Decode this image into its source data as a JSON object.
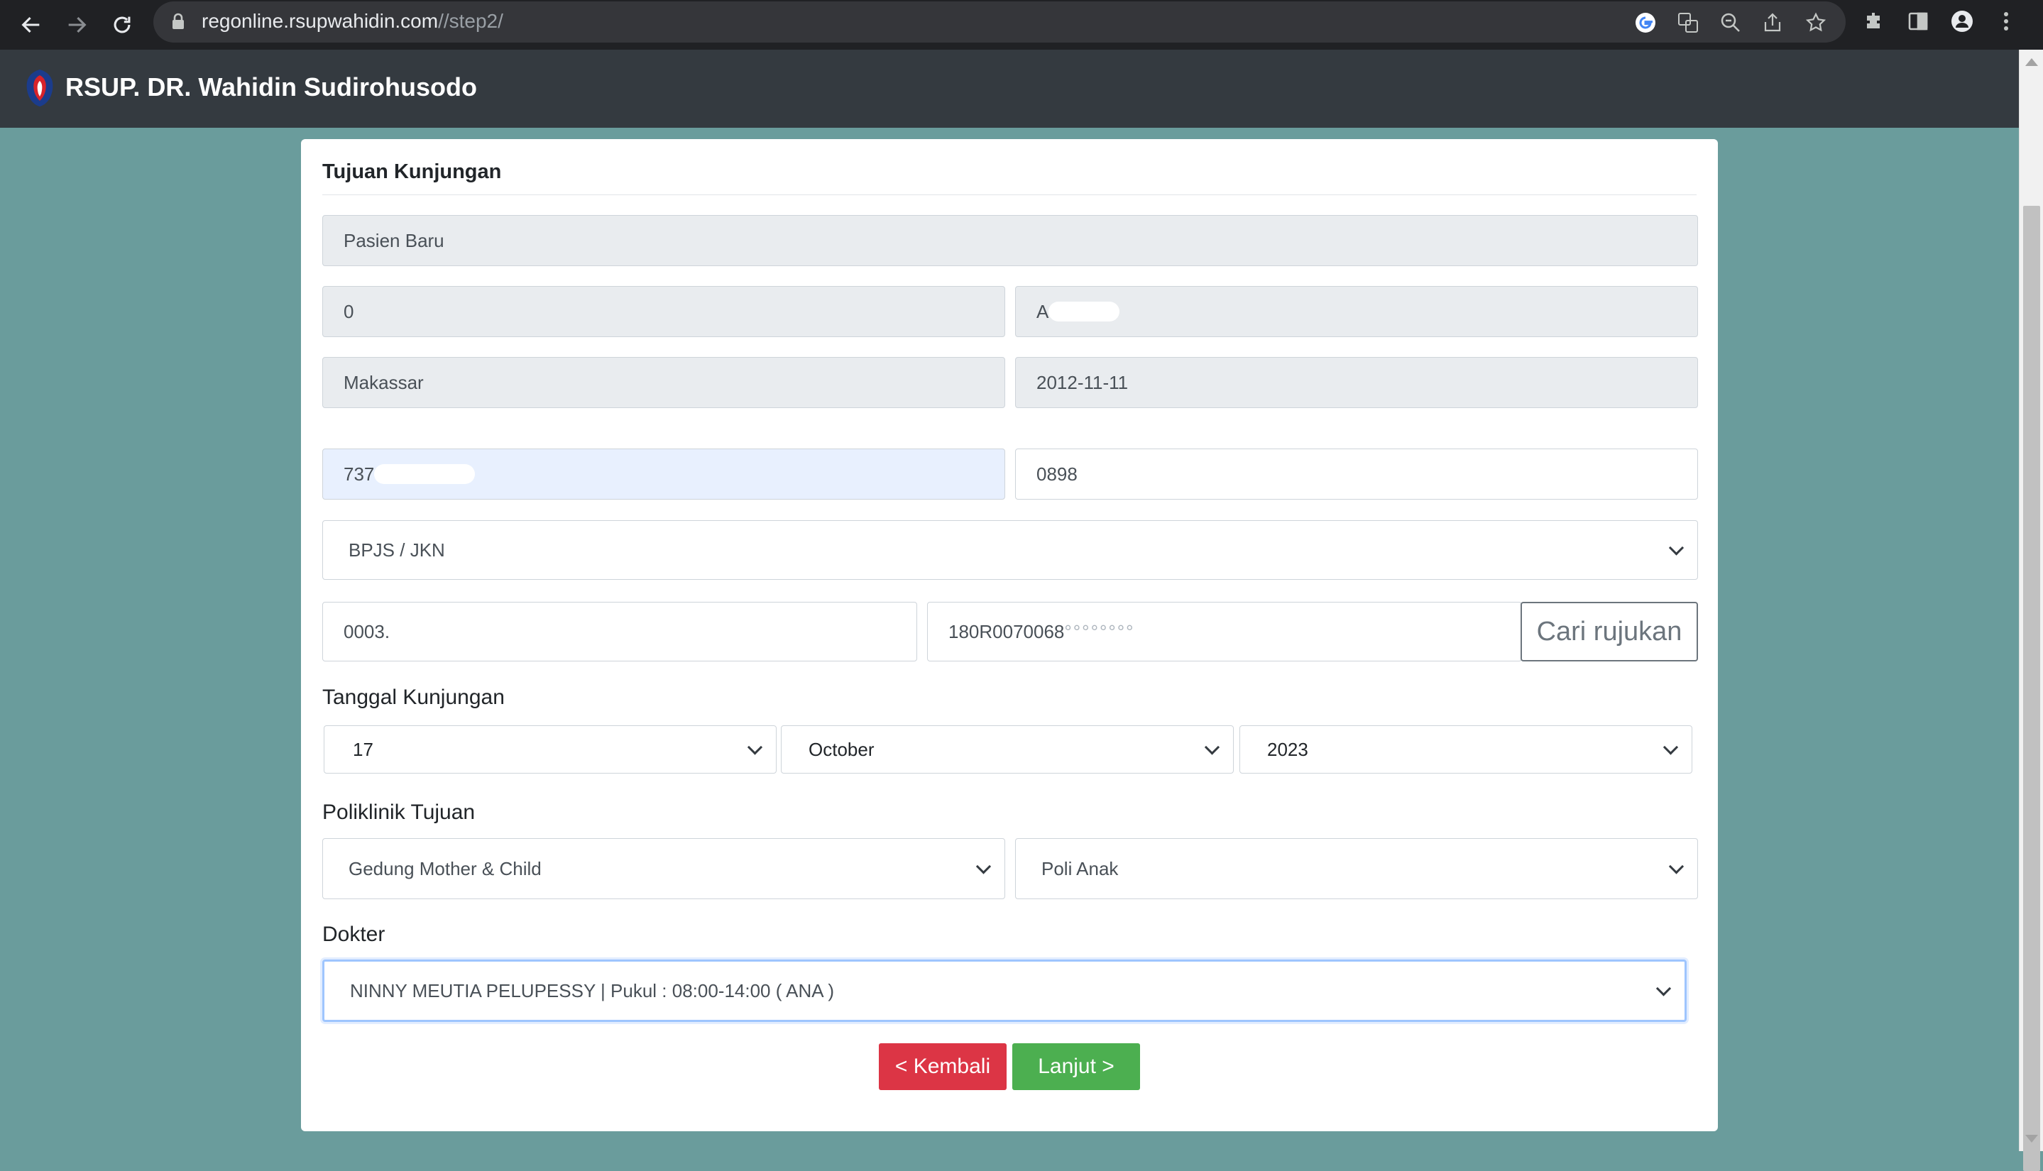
{
  "browser": {
    "url_host": "regonline.rsupwahidin.com",
    "url_path": "//step2/"
  },
  "header": {
    "brand": "RSUP. DR. Wahidin Sudirohusodo"
  },
  "form": {
    "section_title": "Tujuan Kunjungan",
    "patient_type": "Pasien Baru",
    "record_number": "0",
    "name_partial": "A",
    "birth_place": "Makassar",
    "birth_date": "2012-11-11",
    "nik_partial": "737",
    "phone_partial": "0898",
    "payment_method": "BPJS / JKN",
    "bpjs_number_partial": "0003.",
    "referral_number_partial": "180R0070068",
    "search_referral_label": "Cari rujukan",
    "visit_date_label": "Tanggal Kunjungan",
    "visit_day": "17",
    "visit_month": "October",
    "visit_year": "2023",
    "clinic_label": "Poliklinik Tujuan",
    "building": "Gedung Mother & Child",
    "clinic": "Poli Anak",
    "doctor_label": "Dokter",
    "doctor": "NINNY MEUTIA PELUPESSY | Pukul : 08:00-14:00 ( ANA )",
    "back_label": "< Kembali",
    "next_label": "Lanjut >"
  },
  "colors": {
    "page_background": "#6a9c9c",
    "header_background": "#343a40",
    "back_button": "#dc3545",
    "next_button": "#4caf50"
  }
}
